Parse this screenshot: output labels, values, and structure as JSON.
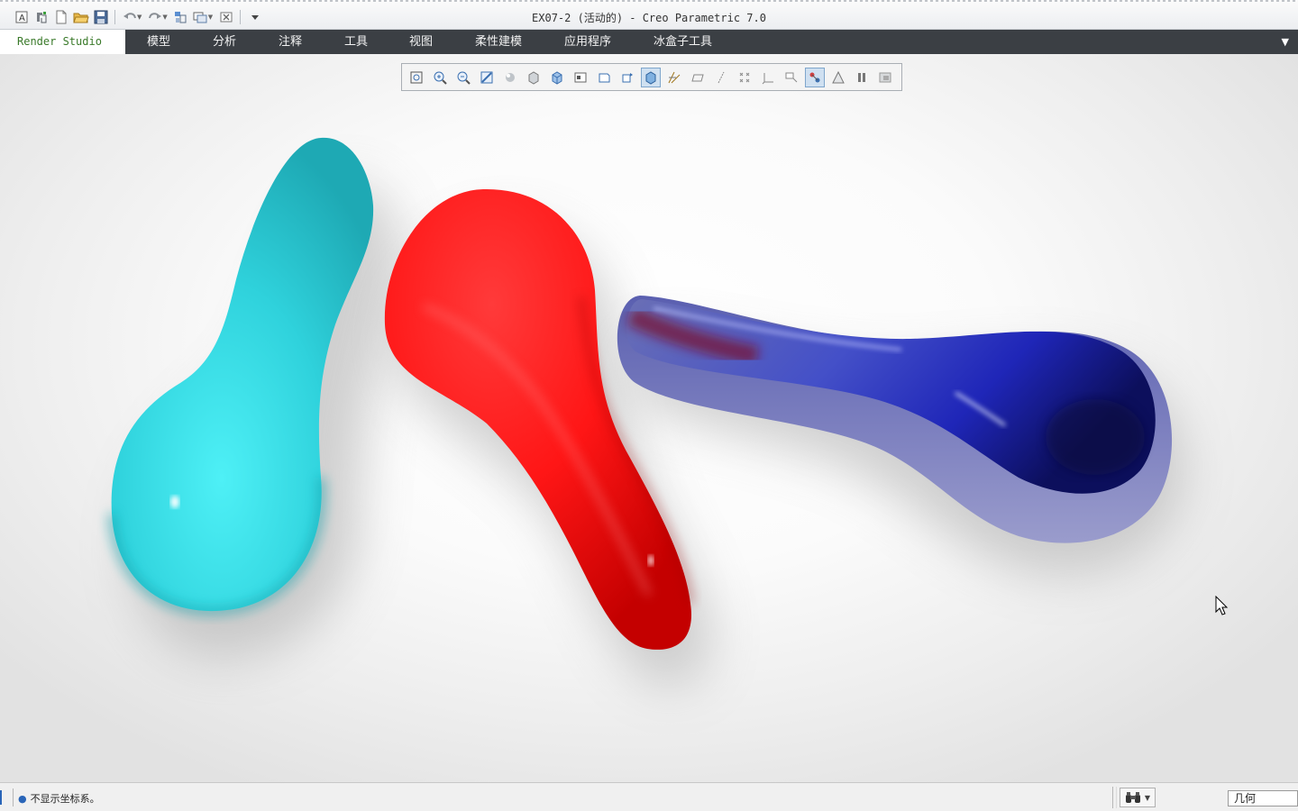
{
  "window": {
    "title": "EX07-2 (活动的) - Creo Parametric 7.0"
  },
  "quick_access": {
    "icons": [
      "text-style-icon",
      "regenerate-icon",
      "new-file-icon",
      "open-folder-icon",
      "save-icon",
      "undo-icon",
      "redo-icon",
      "window-icon",
      "switch-window-icon",
      "close-window-icon",
      "customize-icon"
    ]
  },
  "ribbon": {
    "tabs": [
      {
        "label": "Render Studio",
        "active": true
      },
      {
        "label": "模型"
      },
      {
        "label": "分析"
      },
      {
        "label": "注释"
      },
      {
        "label": "工具"
      },
      {
        "label": "视图"
      },
      {
        "label": "柔性建模"
      },
      {
        "label": "应用程序"
      },
      {
        "label": "冰盒子工具"
      }
    ]
  },
  "view_toolbar": {
    "icons": [
      "refit-icon",
      "zoom-in-icon",
      "zoom-out-icon",
      "repaint-icon",
      "shading-icon",
      "display-style-icon",
      "saved-views-icon",
      "view-manager-icon",
      "perspective-icon",
      "spin-center-icon",
      "render-view-icon",
      "datum-display-icon",
      "plane-display-icon",
      "axis-display-icon",
      "point-display-icon",
      "csys-display-icon",
      "annotation-display-icon",
      "scene-icon",
      "room-icon",
      "pause-icon",
      "render-region-icon"
    ],
    "active_index": 10,
    "secondary_active_index": 17
  },
  "colors": {
    "cyan_model": "#2ed3de",
    "red_model": "#ff1c1c",
    "blue_model": "#1a22c8",
    "ribbon_bg": "#3b3f44",
    "active_tab_text": "#3a7a2a"
  },
  "status": {
    "message": "不显示坐标系。",
    "filter_value": "几何"
  }
}
